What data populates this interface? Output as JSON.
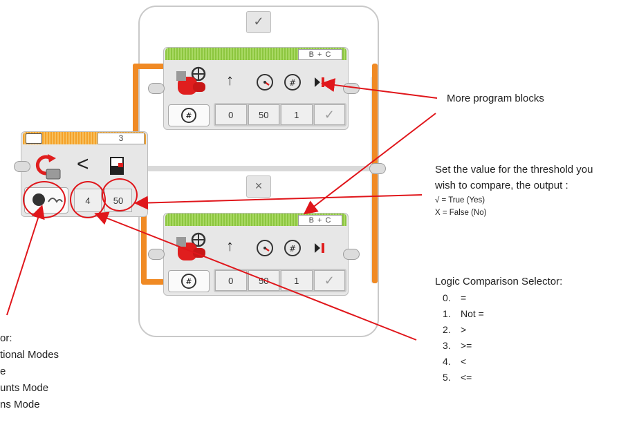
{
  "top_case": {
    "tab_symbol": "✓"
  },
  "bottom_case": {
    "tab_symbol": "×"
  },
  "compare_block": {
    "header_value": "3",
    "operator_symbol": "<",
    "input_a": "4",
    "input_b": "50"
  },
  "motor_top": {
    "port": "B + C",
    "params": [
      "0",
      "50",
      "1",
      "✓"
    ]
  },
  "motor_bottom": {
    "port": "B + C",
    "params": [
      "0",
      "50",
      "1",
      "✓"
    ]
  },
  "annotations": {
    "more_blocks": "More program blocks",
    "threshold_line1": "Set the value for the threshold you",
    "threshold_line2": "wish to compare, the output :",
    "true_label": "√ = True (Yes)",
    "false_label": "X = False (No)",
    "logic_title": "Logic Comparison Selector:",
    "logic_items": [
      {
        "num": "0.",
        "label": "="
      },
      {
        "num": "1.",
        "label": "Not ="
      },
      {
        "num": "2.",
        "label": ">"
      },
      {
        "num": "3.",
        "label": ">="
      },
      {
        "num": "4.",
        "label": "<"
      },
      {
        "num": "5.",
        "label": "<="
      }
    ],
    "mode_fragments": [
      "or:",
      "tional Modes",
      "e",
      "unts Mode",
      "ns Mode"
    ]
  },
  "colors": {
    "arrow_red": "#e0161b",
    "flow_orange": "#f08a24",
    "motor_green": "#8cc63f",
    "sensor_orange": "#f4a22a"
  }
}
